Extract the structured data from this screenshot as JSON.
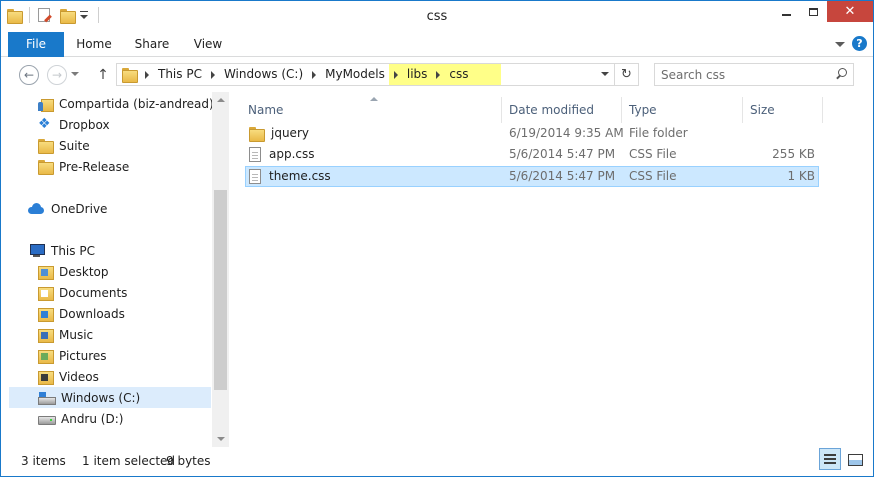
{
  "window": {
    "title": "css"
  },
  "ribbon": {
    "tabs": [
      {
        "label": "File"
      },
      {
        "label": "Home"
      },
      {
        "label": "Share"
      },
      {
        "label": "View"
      }
    ]
  },
  "navigation": {
    "address_parts": [
      "This PC",
      "Windows (C:)",
      "MyModels",
      "libs",
      "css"
    ],
    "search_placeholder": "Search css"
  },
  "nav_pane": {
    "items": [
      {
        "label": "Compartida (biz-andread)",
        "icon": "shared-folder-icon"
      },
      {
        "label": "Dropbox",
        "icon": "dropbox-icon"
      },
      {
        "label": "Suite",
        "icon": "folder-icon"
      },
      {
        "label": "Pre-Release",
        "icon": "folder-icon"
      },
      {
        "label": "OneDrive",
        "icon": "onedrive-icon"
      },
      {
        "label": "This PC",
        "icon": "this-pc-icon"
      },
      {
        "label": "Desktop",
        "icon": "desktop-folder-icon"
      },
      {
        "label": "Documents",
        "icon": "documents-folder-icon"
      },
      {
        "label": "Downloads",
        "icon": "downloads-folder-icon"
      },
      {
        "label": "Music",
        "icon": "music-folder-icon"
      },
      {
        "label": "Pictures",
        "icon": "pictures-folder-icon"
      },
      {
        "label": "Videos",
        "icon": "videos-folder-icon"
      },
      {
        "label": "Windows (C:)",
        "icon": "drive-icon",
        "selected": true
      },
      {
        "label": "Andru (D:)",
        "icon": "removable-drive-icon"
      }
    ]
  },
  "file_list": {
    "columns": [
      "Name",
      "Date modified",
      "Type",
      "Size"
    ],
    "rows": [
      {
        "name": "jquery",
        "date": "6/19/2014 9:35 AM",
        "type": "File folder",
        "size": "",
        "icon": "folder-icon"
      },
      {
        "name": "app.css",
        "date": "5/6/2014 5:47 PM",
        "type": "CSS File",
        "size": "255 KB",
        "icon": "css-file-icon"
      },
      {
        "name": "theme.css",
        "date": "5/6/2014 5:47 PM",
        "type": "CSS File",
        "size": "1 KB",
        "icon": "css-file-icon",
        "selected": true
      }
    ]
  },
  "status": {
    "item_count": "3 items",
    "selection": "1 item selected",
    "selection_size": "9 bytes"
  },
  "colors": {
    "accent": "#1979ca",
    "selection": "#cce8ff",
    "address_highlight": "#ffff88",
    "close_button": "#c7463d"
  }
}
